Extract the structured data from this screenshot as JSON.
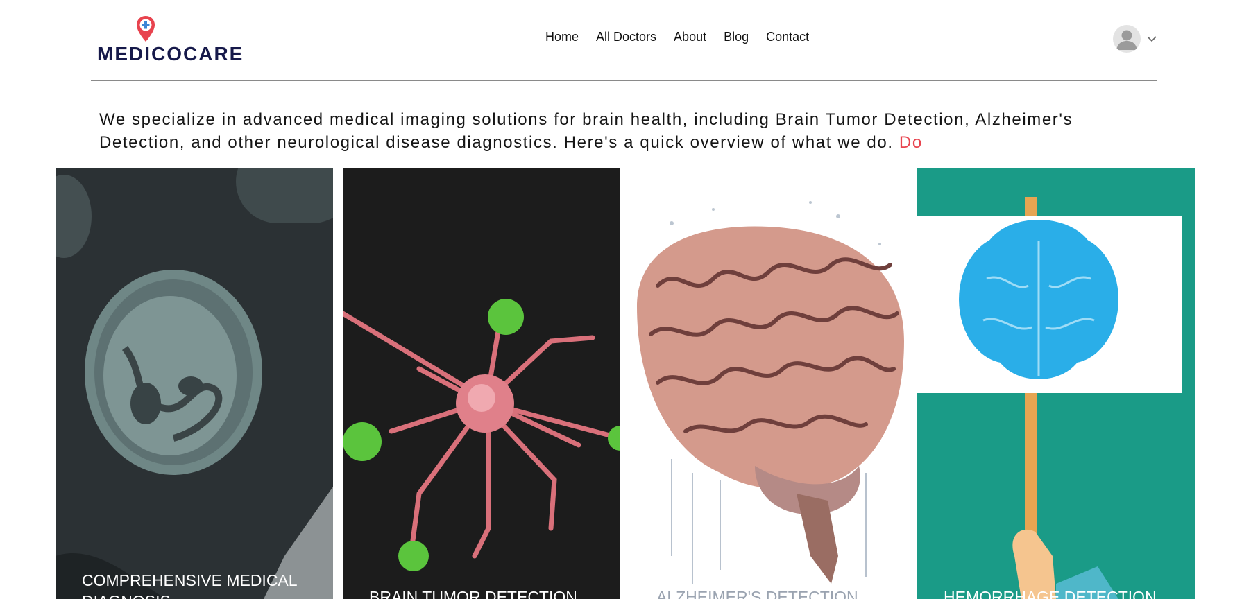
{
  "brand": {
    "name": "MEDICOCARE"
  },
  "nav": {
    "items": [
      "Home",
      "All Doctors",
      "About",
      "Blog",
      "Contact"
    ]
  },
  "user_menu": {
    "avatar_icon": "user-avatar-icon",
    "dropdown_icon": "chevron-down-icon"
  },
  "intro": {
    "text": "We specialize in advanced medical imaging solutions for brain health, including Brain Tumor Detection, Alzheimer's Detection, and other neurological disease diagnostics. Here's a quick overview of what we do.",
    "more_link": "Do"
  },
  "cards": [
    {
      "title": "COMPREHENSIVE MEDICAL DIAGNOSIS"
    },
    {
      "title": "BRAIN TUMOR DETECTION"
    },
    {
      "title": "ALZHEIMER'S DETECTION"
    },
    {
      "title": "HEMORRHAGE DETECTION"
    }
  ],
  "colors": {
    "brand_navy": "#16194a",
    "accent_red": "#e8434e",
    "teal": "#1a9b87",
    "brain_blue": "#2aaee8"
  }
}
